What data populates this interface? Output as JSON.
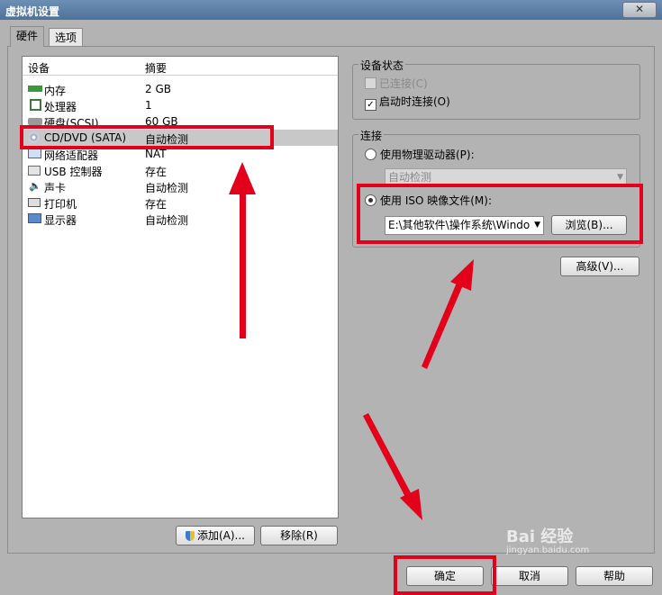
{
  "window": {
    "title": "虚拟机设置",
    "close_glyph": "✕"
  },
  "tabs": [
    {
      "label": "硬件"
    },
    {
      "label": "选项"
    }
  ],
  "device_list": {
    "col_device": "设备",
    "col_summary": "摘要",
    "items": [
      {
        "name": "内存",
        "summary": "2 GB",
        "icon": "memory-icon"
      },
      {
        "name": "处理器",
        "summary": "1",
        "icon": "processor-icon"
      },
      {
        "name": "硬盘(SCSI)",
        "summary": "60 GB",
        "icon": "hard-disk-icon"
      },
      {
        "name": "CD/DVD (SATA)",
        "summary": "自动检测",
        "icon": "cd-dvd-icon"
      },
      {
        "name": "网络适配器",
        "summary": "NAT",
        "icon": "network-adapter-icon"
      },
      {
        "name": "USB 控制器",
        "summary": "存在",
        "icon": "usb-icon"
      },
      {
        "name": "声卡",
        "summary": "自动检测",
        "icon": "sound-card-icon"
      },
      {
        "name": "打印机",
        "summary": "存在",
        "icon": "printer-icon"
      },
      {
        "name": "显示器",
        "summary": "自动检测",
        "icon": "display-icon"
      }
    ],
    "add_label": "添加(A)...",
    "remove_label": "移除(R)"
  },
  "device_status": {
    "legend": "设备状态",
    "connected_label": "已连接(C)",
    "connect_at_power_on_label": "启动时连接(O)"
  },
  "connection": {
    "legend": "连接",
    "physical_drive_label": "使用物理驱动器(P):",
    "physical_drive_value": "自动检测",
    "iso_label": "使用 ISO 映像文件(M):",
    "iso_path": "E:\\其他软件\\操作系统\\Windo",
    "browse_label": "浏览(B)...",
    "advanced_label": "高级(V)..."
  },
  "footer": {
    "ok_label": "确定",
    "cancel_label": "取消",
    "help_label": "帮助"
  },
  "watermark": {
    "brand": "Bai 经验",
    "url": "jingyan.baidu.com"
  },
  "annotation_color": "#e3001b"
}
